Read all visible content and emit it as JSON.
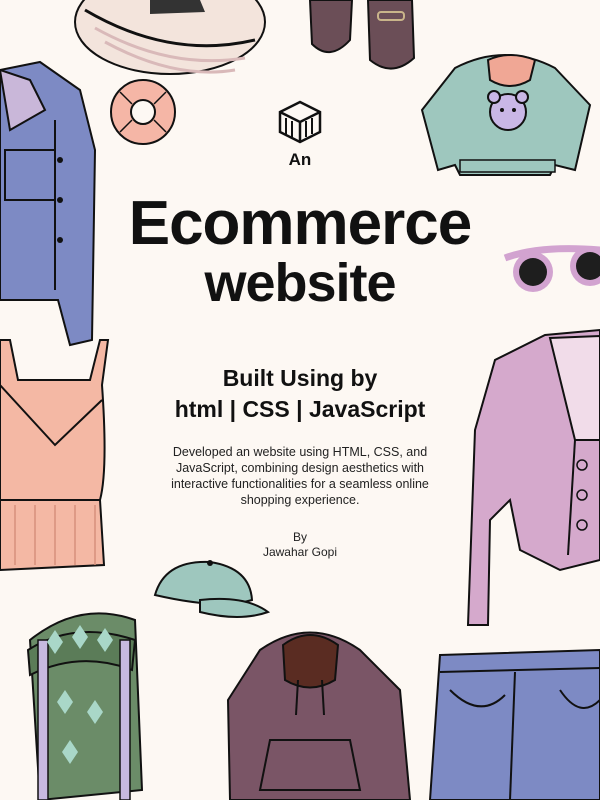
{
  "cover": {
    "intro": "An",
    "title_line1": "Ecommerce",
    "title_line2": "website",
    "built_line1": "Built Using by",
    "built_line2": "html | CSS | JavaScript",
    "description": "Developed an website using HTML, CSS, and JavaScript, combining design aesthetics with interactive functionalities for a seamless online shopping experience.",
    "by_label": "By",
    "author": "Jawahar Gopi"
  },
  "illustrations": [
    "sun-hat",
    "loafers",
    "scrunchie",
    "denim-jacket",
    "bear-sweater",
    "sunglasses",
    "camisole",
    "cardigan",
    "cap",
    "backpack",
    "hoodie",
    "jeans"
  ],
  "colors": {
    "background": "#fdf8f3",
    "text": "#111111",
    "denim": "#7d8ac4",
    "peach": "#f4b8a4",
    "lilac": "#d5a9cc",
    "sage": "#9ec7be",
    "green": "#6b8c68",
    "plum": "#7a5566"
  }
}
